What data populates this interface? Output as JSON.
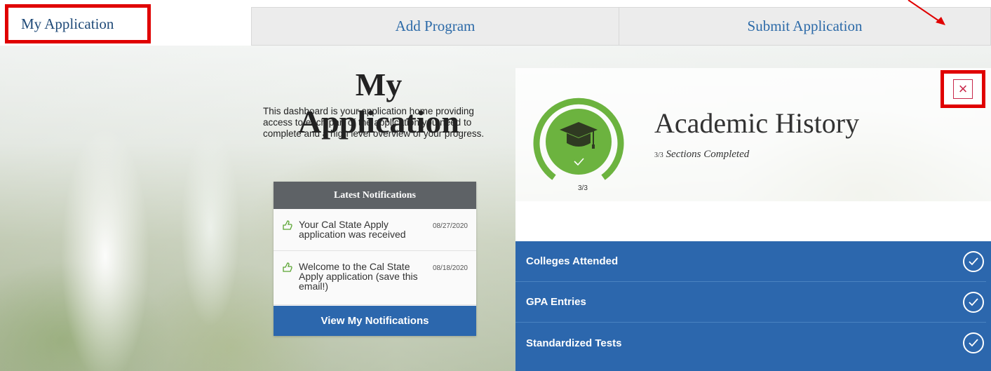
{
  "nav": {
    "my_application": "My Application",
    "add_program": "Add Program",
    "submit_application": "Submit Application"
  },
  "dashboard": {
    "title": "My Application",
    "description": "This dashboard is your application home providing access to each part of the application you need to complete and a high level overview of your progress."
  },
  "notifications": {
    "header": "Latest Notifications",
    "items": [
      {
        "text": "Your Cal State Apply application was received",
        "date": "08/27/2020"
      },
      {
        "text": "Welcome to the Cal State Apply application (save this email!)",
        "date": "08/18/2020"
      }
    ],
    "button": "View My Notifications"
  },
  "panel": {
    "title": "Academic History",
    "progress_fraction": "3/3",
    "progress_subtitle": "Sections Completed",
    "gauge_label": "3/3",
    "progress_value": 1.0,
    "close_symbol": "×",
    "sections": [
      {
        "label": "Colleges Attended",
        "complete": true
      },
      {
        "label": "GPA Entries",
        "complete": true
      },
      {
        "label": "Standardized Tests",
        "complete": true
      }
    ]
  },
  "colors": {
    "accent_blue": "#2c67ad",
    "gauge_green": "#6cb33f",
    "highlight_red": "#e00000",
    "close_red": "#c8284a"
  }
}
